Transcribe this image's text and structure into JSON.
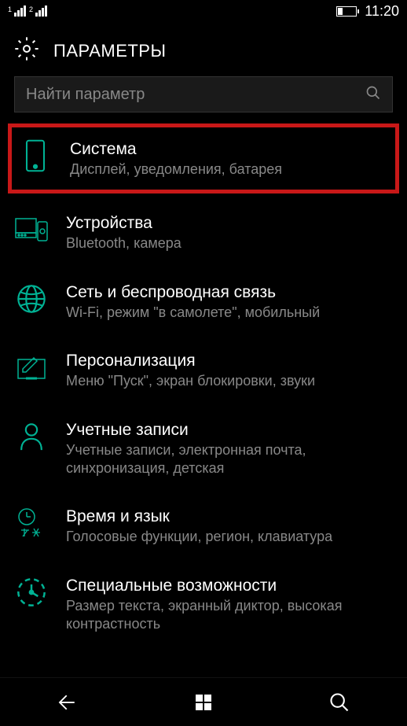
{
  "status": {
    "sim1": "1",
    "sim2": "2",
    "time": "11:20"
  },
  "header": {
    "title": "ПАРАМЕТРЫ"
  },
  "search": {
    "placeholder": "Найти параметр"
  },
  "settings": [
    {
      "title": "Система",
      "desc": "Дисплей, уведомления, батарея",
      "highlighted": true
    },
    {
      "title": "Устройства",
      "desc": "Bluetooth, камера"
    },
    {
      "title": "Сеть и беспроводная связь",
      "desc": "Wi-Fi, режим \"в самолете\", мобильный"
    },
    {
      "title": "Персонализация",
      "desc": "Меню \"Пуск\", экран блокировки, звуки"
    },
    {
      "title": "Учетные записи",
      "desc": "Учетные записи, электронная почта, синхронизация, детская"
    },
    {
      "title": "Время и язык",
      "desc": "Голосовые функции, регион, клавиатура"
    },
    {
      "title": "Специальные возможности",
      "desc": "Размер текста, экранный диктор, высокая контрастность"
    }
  ]
}
